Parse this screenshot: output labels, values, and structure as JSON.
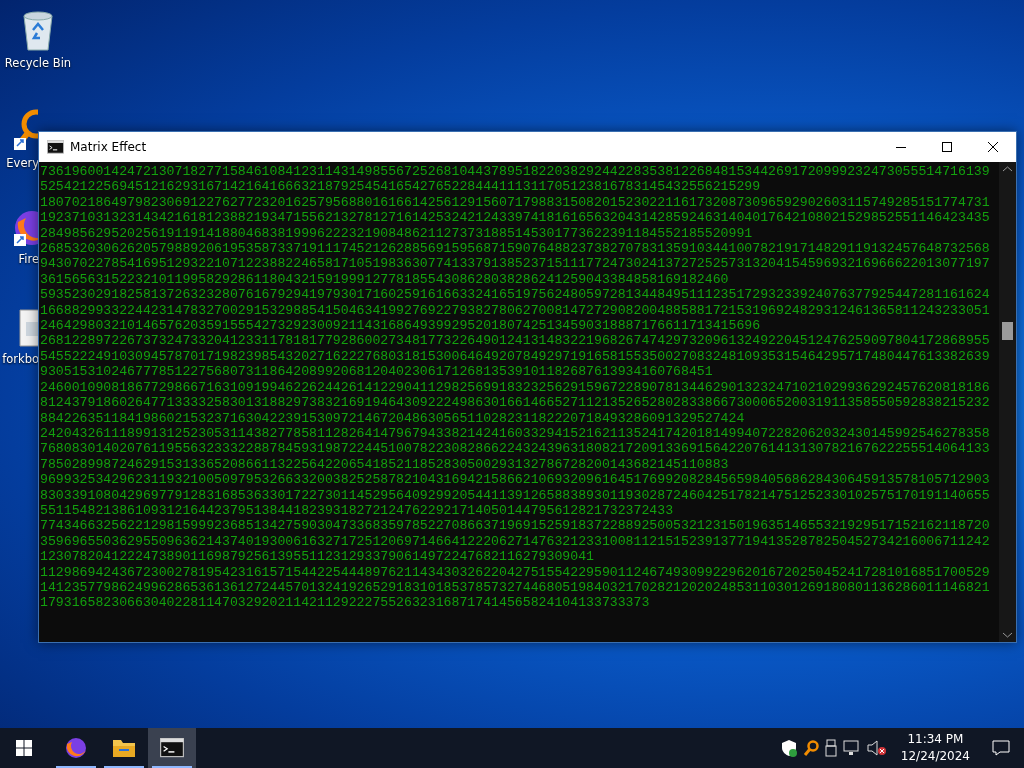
{
  "desktop_icons": [
    {
      "kind": "recycle",
      "label": "Recycle Bin"
    },
    {
      "kind": "app",
      "label": "Every"
    },
    {
      "kind": "browser",
      "label": "Fire"
    },
    {
      "kind": "file",
      "label": "forkbo"
    }
  ],
  "window": {
    "title": "Matrix Effect",
    "lines": [
      "736196001424721307182771584610841231143149855672526810443789518220382924422835381226848153442691720999232473055514716139",
      "5254212256945121629316714216416663218792545416542765228444111311705123816783145432556215299",
      "180702186497982306912276277232016257956880161661425612915607179883150820152302211617320873096592902603115749285151774731",
      "192371031323143421618123882193471556213278127161425324212433974181616563204314285924631404017642108021529852551146423435",
      "284985629520256191191418804683819996222321908486211273731885145301773622391184552185520991",
      "268532030626205798892061953587337191117452126288569159568715907648823738270783135910344100782191714829119132457648732568",
      "943070227854169512932210712238822465817105198363077413379138523715111772473024137272525731320415459693216966622013077197",
      "361565631522321011995829286118043215919991277818554308628038286241259043384858169182460",
      "593523029182581372632328076167929419793017160259161663324165197562480597281344849511123517293233924076377925447281161624",
      "166882993322442314783270029153298854150463419927692279382780627008147272908200488588172153196924829312461365811243233051",
      "2464298032101465762035915554273292300921143168649399295201807425134590318887176611713415696",
      "268122897226737324733204123311781817792860027348177322649012413148322196826747429732096132492204512476259097804172868955",
      "545522249103094578701719823985432027162227680318153006464920784929719165815535002708324810935315464295717480447613382639",
      "9305153102467778512275680731186420899206812040230617126813539101182687613934160768451",
      "246001090818677298667163109199462262442614122904112982569918323256291596722890781344629013232471021029936292457620818186",
      "812437918602647713333258301318829738321691946430922249863016614665271121352652802833866730006520031911358550592838215232",
      "88422635118419860215323716304223915309721467204863056511028231182220718493286091329527424",
      "242043261118991312523053114382778581128264147967943382142416033294152162113524174201814994072282062032430145992546278358",
      "768083014020761195563233322887845931987224451007822308286622432439631808217209133691564220761413130782167622255514064133",
      "785028998724629153133652086611322564220654185211852830500293132786728200143682145110883",
      "969932534296231193210050979532663320038252587821043169421586621069320961645176992082845659840568628430645913578105712903",
      "830339108042969779128316853633017227301145295640929920544113912658838930119302872460425178214751252330102575170191140655",
      "55115482138610931216442379513844182393182721247622921714050144795612821732372433",
      "774346632562212981599923685134275903047336835978522708663719691525918372288925005321231501963514655321929517152162118720",
      "359696550362955096362143740193006163271725120697146641222062714763212331008112151523913771941352878250452734216006711242",
      "1230782041222473890116987925613955112312933790614972247682116279309041",
      "112986942436723002781954231615715442254448976211434303262204275155422959011246749309922962016720250452417281016851700529",
      "141235779862499628653613612724457013241926529183101853785732744680519840321702821202024853110301269180801136286011146821",
      "17931658230663040228114703292021142112922275526323168717414565824104133733373"
    ]
  },
  "taskbar": {
    "apps": [
      {
        "kind": "browser",
        "selected": false
      },
      {
        "kind": "folder",
        "selected": false
      },
      {
        "kind": "terminal",
        "selected": true
      }
    ],
    "time": "11:34 PM",
    "date": "12/24/2024"
  }
}
